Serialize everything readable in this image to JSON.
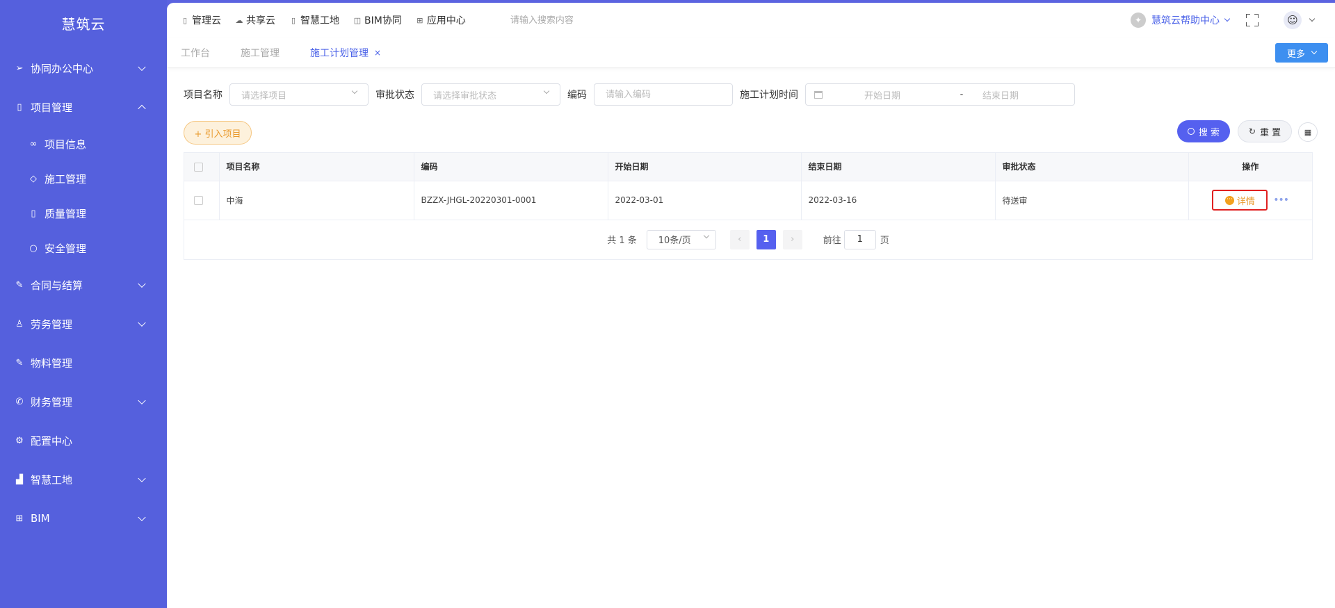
{
  "sidebar": {
    "brand": "慧筑云",
    "items": [
      {
        "icon": "send-icon",
        "label": "协同办公中心"
      },
      {
        "icon": "book-icon",
        "label": "项目管理"
      },
      {
        "icon": "glasses-icon",
        "label": "项目信息"
      },
      {
        "icon": "tag-icon",
        "label": "施工管理"
      },
      {
        "icon": "book-icon",
        "label": "质量管理"
      },
      {
        "icon": "location-icon",
        "label": "安全管理"
      },
      {
        "icon": "edit-icon",
        "label": "合同与结算"
      },
      {
        "icon": "user-icon",
        "label": "劳务管理"
      },
      {
        "icon": "edit-icon",
        "label": "物料管理"
      },
      {
        "icon": "phone-icon",
        "label": "财务管理"
      },
      {
        "icon": "gear-icon",
        "label": "配置中心"
      },
      {
        "icon": "bar-chart-icon",
        "label": "智慧工地"
      },
      {
        "icon": "grid-icon",
        "label": "BIM"
      }
    ]
  },
  "topnav": {
    "items": [
      {
        "icon": "book-icon",
        "label": "管理云"
      },
      {
        "icon": "cloud-icon",
        "label": "共享云"
      },
      {
        "icon": "book-icon",
        "label": "智慧工地"
      },
      {
        "icon": "cube-icon",
        "label": "BIM协同"
      },
      {
        "icon": "grid-icon",
        "label": "应用中心"
      }
    ],
    "search_placeholder": "请输入搜索内容",
    "help_label": "慧筑云帮助中心"
  },
  "tabs": {
    "items": [
      "工作台",
      "施工管理",
      "施工计划管理"
    ],
    "close_symbol": "×",
    "more_label": "更多"
  },
  "filters": {
    "project_name_label": "项目名称",
    "project_name_placeholder": "请选择项目",
    "approval_status_label": "审批状态",
    "approval_status_placeholder": "请选择审批状态",
    "code_label": "编码",
    "code_placeholder": "请输入编码",
    "plan_time_label": "施工计划时间",
    "start_date_placeholder": "开始日期",
    "date_separator": "-",
    "end_date_placeholder": "结束日期"
  },
  "actions": {
    "import_label": "+ 引入项目",
    "search_label": "搜 索",
    "reset_label": "重 置"
  },
  "table": {
    "headers": [
      "项目名称",
      "编码",
      "开始日期",
      "结束日期",
      "审批状态",
      "操作"
    ],
    "rows": [
      {
        "name": "中海",
        "code": "BZZX-JHGL-20220301-0001",
        "start_date": "2022-03-01",
        "end_date": "2022-03-16",
        "status": "待送审",
        "detail_label": "详情",
        "more_symbol": "•••"
      }
    ]
  },
  "pagination": {
    "total": "共 1 条",
    "page_size": "10条/页",
    "prev_symbol": "‹",
    "current_page": "1",
    "next_symbol": "›",
    "goto_label": "前往",
    "goto_value": "1",
    "page_unit": "页"
  },
  "colors": {
    "sidebar_bg": "#5560dd",
    "accent": "#4c63e8",
    "primary_button": "#5560ef",
    "import_button": "#e99a2c",
    "highlight_border": "#e02020"
  }
}
